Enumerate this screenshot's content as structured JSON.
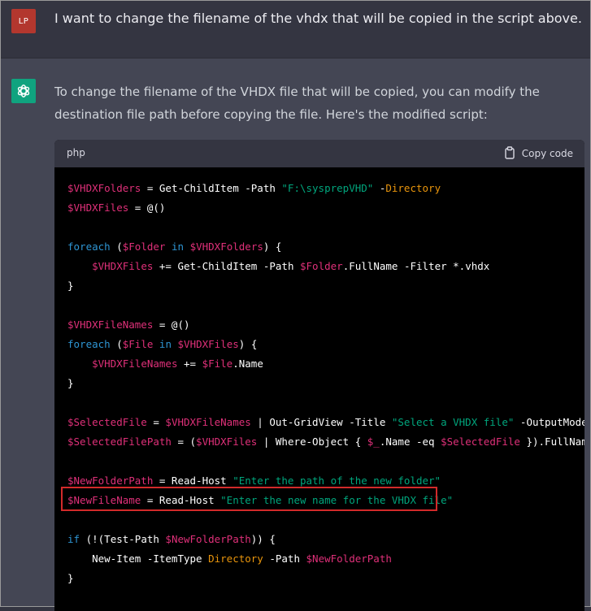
{
  "user": {
    "initials": "LP",
    "message": "I want to change the filename of the vhdx that will be copied in the script above."
  },
  "assistant": {
    "icon": "openai-logo-icon",
    "reply": "To change the filename of the VHDX file that will be copied, you can modify the destination file path before copying the file. Here's the modified script:"
  },
  "code_block": {
    "language": "php",
    "copy_label": "Copy code",
    "lines": [
      [
        [
          "v",
          "$VHDXFolders"
        ],
        [
          "t",
          " = Get-ChildItem -Path "
        ],
        [
          "s",
          "\"F:\\sysprepVHD\""
        ],
        [
          "t",
          " -"
        ],
        [
          "p",
          "Directory"
        ]
      ],
      [
        [
          "v",
          "$VHDXFiles"
        ],
        [
          "t",
          " = @()"
        ]
      ],
      [],
      [
        [
          "k",
          "foreach"
        ],
        [
          "t",
          " ("
        ],
        [
          "v",
          "$Folder"
        ],
        [
          "t",
          " "
        ],
        [
          "k",
          "in"
        ],
        [
          "t",
          " "
        ],
        [
          "v",
          "$VHDXFolders"
        ],
        [
          "t",
          ") {"
        ]
      ],
      [
        [
          "t",
          "    "
        ],
        [
          "v",
          "$VHDXFiles"
        ],
        [
          "t",
          " += Get-ChildItem -Path "
        ],
        [
          "v",
          "$Folder"
        ],
        [
          "t",
          ".FullName -Filter *.vhdx"
        ]
      ],
      [
        [
          "t",
          "}"
        ]
      ],
      [],
      [
        [
          "v",
          "$VHDXFileNames"
        ],
        [
          "t",
          " = @()"
        ]
      ],
      [
        [
          "k",
          "foreach"
        ],
        [
          "t",
          " ("
        ],
        [
          "v",
          "$File"
        ],
        [
          "t",
          " "
        ],
        [
          "k",
          "in"
        ],
        [
          "t",
          " "
        ],
        [
          "v",
          "$VHDXFiles"
        ],
        [
          "t",
          ") {"
        ]
      ],
      [
        [
          "t",
          "    "
        ],
        [
          "v",
          "$VHDXFileNames"
        ],
        [
          "t",
          " += "
        ],
        [
          "v",
          "$File"
        ],
        [
          "t",
          ".Name"
        ]
      ],
      [
        [
          "t",
          "}"
        ]
      ],
      [],
      [
        [
          "v",
          "$SelectedFile"
        ],
        [
          "t",
          " = "
        ],
        [
          "v",
          "$VHDXFileNames"
        ],
        [
          "t",
          " | Out-GridView -Title "
        ],
        [
          "s",
          "\"Select a VHDX file\""
        ],
        [
          "t",
          " -OutputMode Single"
        ]
      ],
      [
        [
          "v",
          "$SelectedFilePath"
        ],
        [
          "t",
          " = ("
        ],
        [
          "v",
          "$VHDXFiles"
        ],
        [
          "t",
          " | Where-Object { "
        ],
        [
          "v",
          "$_"
        ],
        [
          "t",
          ".Name -eq "
        ],
        [
          "v",
          "$SelectedFile"
        ],
        [
          "t",
          " }).FullName"
        ]
      ],
      [],
      [
        [
          "v",
          "$NewFolderPath"
        ],
        [
          "t",
          " = Read-Host "
        ],
        [
          "s",
          "\"Enter the path of the new folder\""
        ]
      ],
      [
        [
          "v",
          "$NewFileName"
        ],
        [
          "t",
          " = Read-Host "
        ],
        [
          "s",
          "\"Enter the new name for the VHDX file\""
        ]
      ],
      [],
      [
        [
          "k",
          "if"
        ],
        [
          "t",
          " (!(Test-Path "
        ],
        [
          "v",
          "$NewFolderPath"
        ],
        [
          "t",
          ")) {"
        ]
      ],
      [
        [
          "t",
          "    New-Item -ItemType "
        ],
        [
          "p",
          "Directory"
        ],
        [
          "t",
          " -Path "
        ],
        [
          "v",
          "$NewFolderPath"
        ]
      ],
      [
        [
          "t",
          "}"
        ]
      ]
    ]
  }
}
